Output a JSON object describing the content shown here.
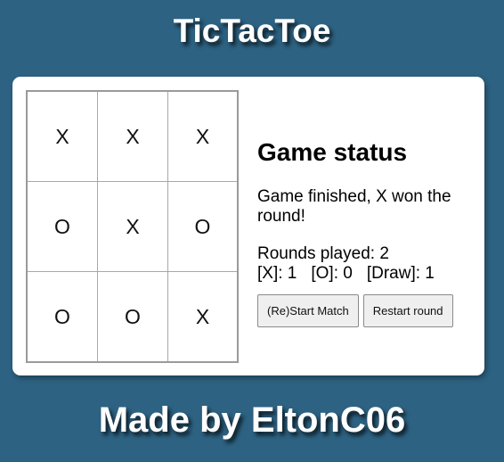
{
  "header": {
    "title": "TicTacToe"
  },
  "board": {
    "cells": [
      "X",
      "X",
      "X",
      "O",
      "X",
      "O",
      "O",
      "O",
      "X"
    ]
  },
  "status": {
    "heading": "Game status",
    "message": "Game finished, X won the round!",
    "rounds_played": "Rounds played: 2",
    "score_x": "[X]: 1",
    "score_o": "[O]: 0",
    "score_draw": "[Draw]: 1"
  },
  "buttons": {
    "restart_match": "(Re)Start Match",
    "restart_round": "Restart round"
  },
  "footer": {
    "text": "Made by EltonC06"
  },
  "colors": {
    "background": "#2d6282",
    "card": "#ffffff",
    "cell_border": "#a8a8a8"
  }
}
